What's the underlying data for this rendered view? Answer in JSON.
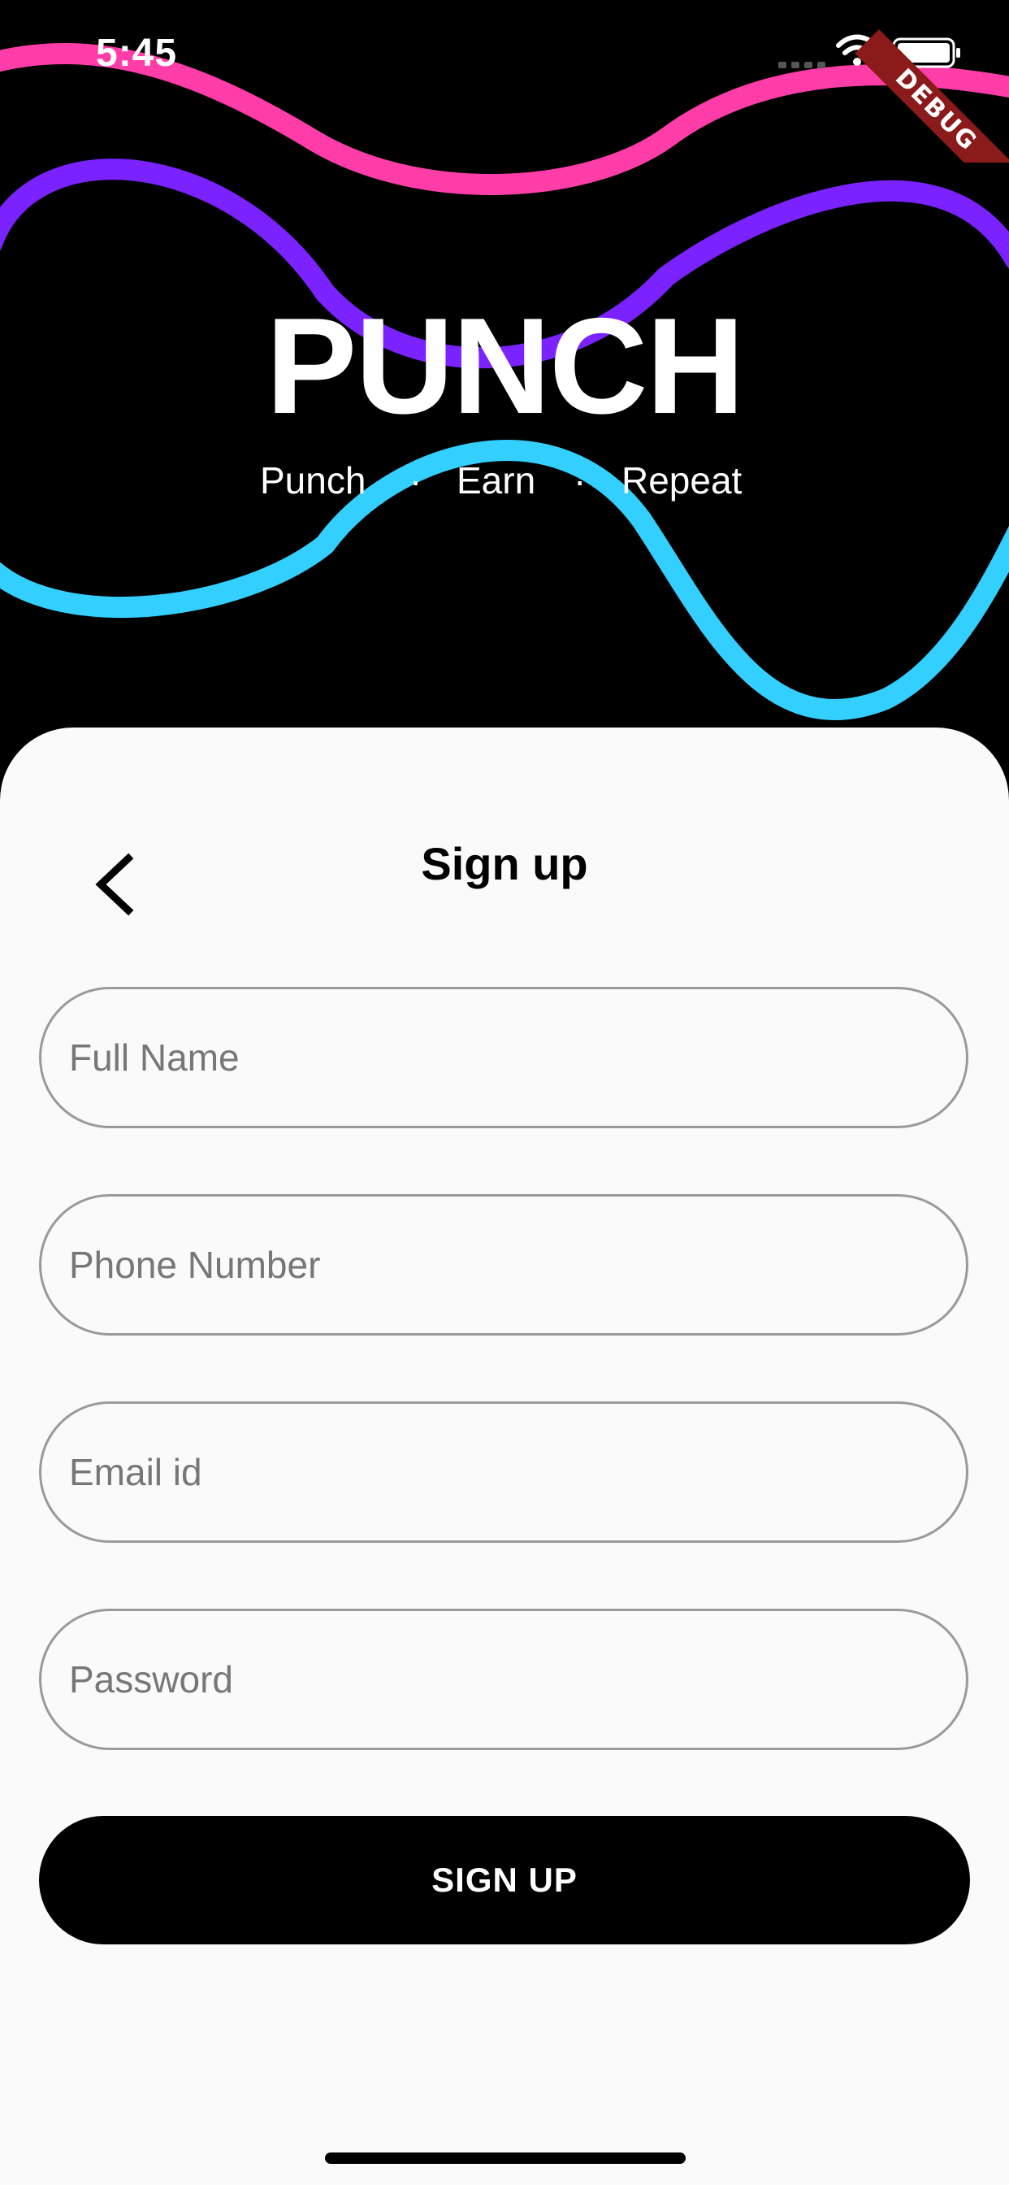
{
  "status_bar": {
    "time": "5:45",
    "icons": [
      "signal-icon",
      "wifi-icon",
      "battery-icon"
    ]
  },
  "debug_banner": {
    "label": "DEBUG",
    "color": "#8b1a1a"
  },
  "header": {
    "brand_title": "PUNCH",
    "tagline": {
      "items": [
        "Punch",
        "Earn",
        "Repeat"
      ],
      "separator": "·"
    },
    "wave_colors": [
      "#ff3da8",
      "#7a22ff",
      "#33cfff"
    ]
  },
  "form": {
    "back_icon": "chevron-left-icon",
    "title": "Sign up",
    "fields": [
      {
        "name": "full-name",
        "placeholder": "Full Name"
      },
      {
        "name": "phone-number",
        "placeholder": "Phone Number"
      },
      {
        "name": "email",
        "placeholder": "Email id"
      },
      {
        "name": "password",
        "placeholder": "Password"
      }
    ],
    "submit_label": "SIGN UP"
  },
  "colors": {
    "card_background": "#fafafa",
    "header_background": "#000000",
    "button_background": "#000000",
    "button_text": "#ffffff"
  }
}
